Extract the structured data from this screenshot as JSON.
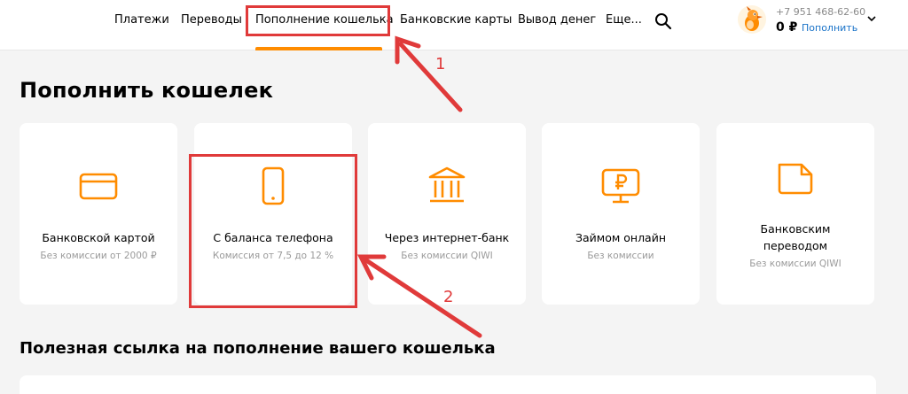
{
  "header": {
    "nav": [
      {
        "label": "Платежи"
      },
      {
        "label": "Переводы"
      },
      {
        "label": "Пополнение кошелька"
      },
      {
        "label": "Банковские карты"
      },
      {
        "label": "Вывод денег"
      },
      {
        "label": "Еще..."
      }
    ],
    "phone": "+7 951 468-62-60",
    "balance": "0 ₽",
    "topup_label": "Пополнить",
    "accent_color": "#ff8c00"
  },
  "page_title": "Пополнить кошелек",
  "cards": [
    {
      "icon": "card-icon",
      "title": "Банковской картой",
      "subtitle": "Без комиссии от 2000 ₽"
    },
    {
      "icon": "phone-icon",
      "title": "С баланса телефона",
      "subtitle": "Комиссия от 7,5 до 12 %"
    },
    {
      "icon": "bank-icon",
      "title": "Через интернет-банк",
      "subtitle": "Без комиссии QIWI"
    },
    {
      "icon": "monitor-ruble-icon",
      "title": "Займом онлайн",
      "subtitle": "Без комиссии"
    },
    {
      "icon": "document-icon",
      "title": "Банковским переводом",
      "subtitle": "Без комиссии QIWI"
    }
  ],
  "section_title": "Полезная ссылка на пополнение вашего кошелька",
  "annotations": {
    "label_1": "1",
    "label_2": "2",
    "color": "#e03a3a"
  }
}
